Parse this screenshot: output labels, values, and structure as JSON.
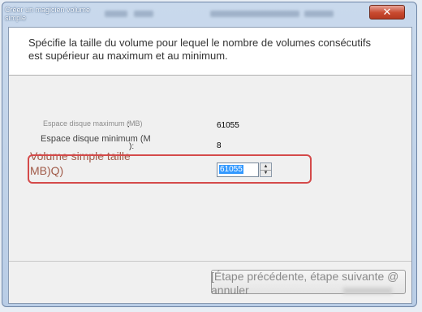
{
  "window": {
    "title": "Créer un magicien volume simple",
    "close_label": "✕"
  },
  "header": {
    "description": "Spécifie la taille du volume pour lequel le nombre de volumes consécutifs est supérieur au maximum et au minimum."
  },
  "fields": {
    "max_label": "Espace disque maximum (MB)",
    "max_colon": ":",
    "max_value": "61055",
    "min_label": "Espace disque minimum (M",
    "min_colon": "):",
    "min_value": "8",
    "size_label": "Volume simple taille MB)Q)",
    "size_value": "61055"
  },
  "footer": {
    "buttons_text": "[Étape précédente, étape suivante @ annuler"
  },
  "colors": {
    "highlight": "#d44a4a",
    "selection": "#3399ff",
    "close_button": "#c8492f"
  }
}
